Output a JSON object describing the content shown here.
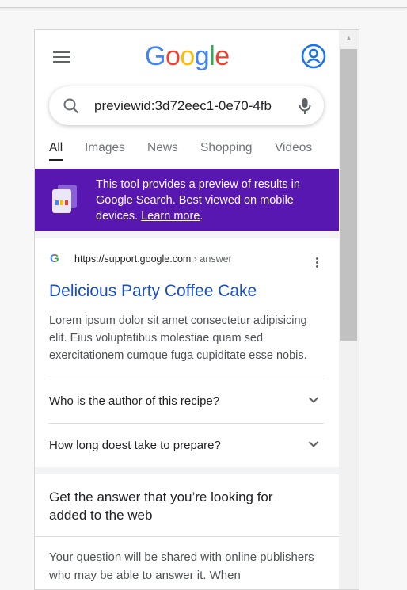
{
  "header": {
    "logo_letters": [
      "G",
      "o",
      "o",
      "g",
      "l",
      "e"
    ]
  },
  "search": {
    "value": "previewid:3d72eec1-0e70-4fb"
  },
  "tabs": [
    {
      "label": "All",
      "active": true
    },
    {
      "label": "Images",
      "active": false
    },
    {
      "label": "News",
      "active": false
    },
    {
      "label": "Shopping",
      "active": false
    },
    {
      "label": "Videos",
      "active": false
    }
  ],
  "banner": {
    "text": "This tool provides a preview of results in Google Search. Best viewed on mobile devices.",
    "link": "Learn more",
    "suffix": ".",
    "color": "#5717b0"
  },
  "result": {
    "url_domain": "https://support.google.com",
    "url_path": " › answer",
    "title": "Delicious Party Coffee Cake",
    "snippet": "Lorem ipsum dolor sit amet consectetur adipisicing elit. Eius voluptatibus molestiae quam sed exercitationem cumque fuga cupiditate esse nobis."
  },
  "faqs": [
    {
      "question": "Who is the author of this recipe?"
    },
    {
      "question": "How long doest take to prepare?"
    }
  ],
  "answer_card": {
    "title": "Get the answer that you’re looking for added to the web",
    "body": "Your question will be shared with online publishers who may be able to answer it. When"
  },
  "colors": {
    "link_blue": "#1a4fbf",
    "banner_purple": "#5717b0",
    "account_blue": "#1a73e8"
  },
  "icons": [
    "menu-icon",
    "account-icon",
    "search-icon",
    "mic-icon",
    "preview-tool-icon",
    "google-favicon-icon",
    "more-vert-icon",
    "chevron-down-icon"
  ]
}
